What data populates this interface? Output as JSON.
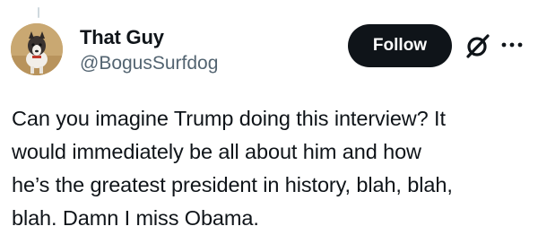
{
  "author": {
    "display_name": "That Guy",
    "handle": "@BogusSurfdog"
  },
  "actions": {
    "follow_label": "Follow",
    "grok_icon": "grok-slash-icon",
    "more_icon": "more-dots-icon"
  },
  "tweet": {
    "text": "Can you imagine Trump doing this interview? It\nwould immediately be all about him and how\nhe’s the greatest president in history, blah, blah,\nblah. Damn I miss Obama."
  },
  "colors": {
    "text_primary": "#0f1419",
    "text_secondary": "#536471",
    "follow_bg": "#0f1419",
    "follow_text": "#ffffff"
  }
}
